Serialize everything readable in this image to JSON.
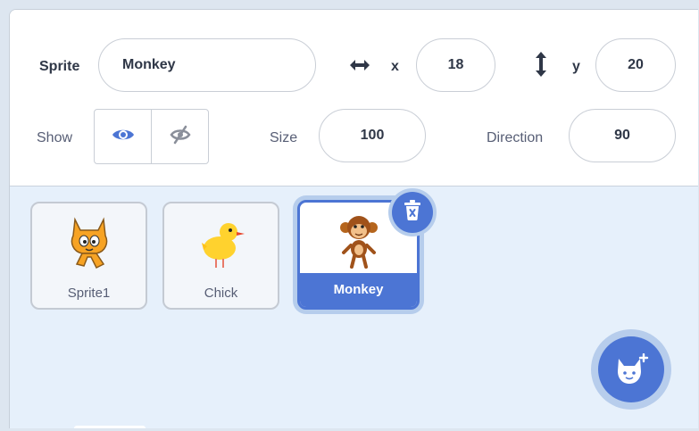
{
  "sprite_info": {
    "sprite_label": "Sprite",
    "sprite_name": "Monkey",
    "x_label": "x",
    "x_value": "18",
    "y_label": "y",
    "y_value": "20",
    "show_label": "Show",
    "size_label": "Size",
    "size_value": "100",
    "direction_label": "Direction",
    "direction_value": "90"
  },
  "sprites": [
    {
      "name": "Sprite1",
      "icon": "cat-sprite-icon",
      "selected": false
    },
    {
      "name": "Chick",
      "icon": "chick-sprite-icon",
      "selected": false
    },
    {
      "name": "Monkey",
      "icon": "monkey-sprite-icon",
      "selected": true
    }
  ],
  "colors": {
    "accent": "#4c75d4",
    "accent_light": "#b6cdec",
    "pane_bg": "#e6f0fb",
    "text": "#575e75"
  },
  "icons": {
    "x": "horizontal-arrows-icon",
    "y": "vertical-arrows-icon",
    "show": "eye-icon",
    "hide": "eye-slash-icon",
    "delete": "trash-icon",
    "add_sprite": "add-sprite-cat-icon"
  }
}
